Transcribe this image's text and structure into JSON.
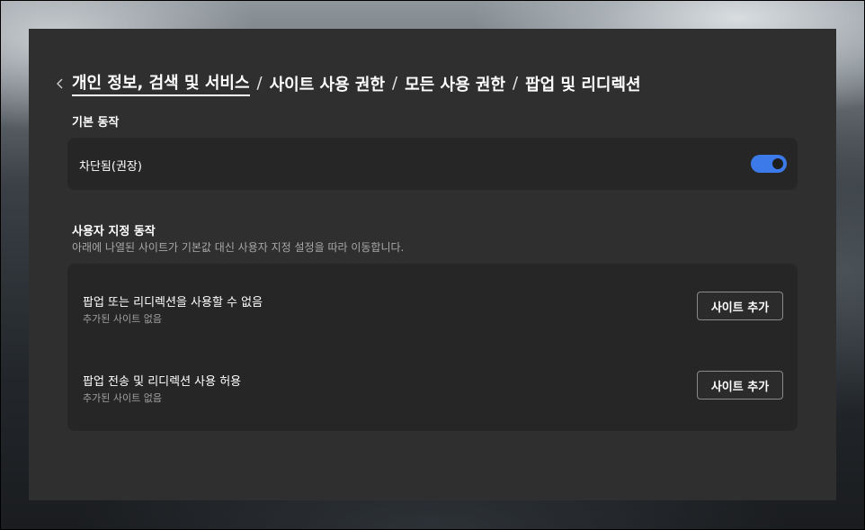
{
  "breadcrumb": {
    "items": [
      "개인 정보, 검색 및 서비스",
      "사이트 사용 권한",
      "모든 사용 권한",
      "팝업 및 리디렉션"
    ],
    "separator": "/"
  },
  "default_behavior": {
    "title": "기본 동작",
    "setting_label": "차단됨(권장)",
    "toggle_on": true,
    "toggle_color": "#3b7ae8"
  },
  "custom_behavior": {
    "title": "사용자 지정 동작",
    "description": "아래에 나열된 사이트가 기본값 대신 사용자 지정 설정을 따라 이동합니다.",
    "rows": [
      {
        "label": "팝업 또는 리디렉션을 사용할 수 없음",
        "sublabel": "추가된 사이트 없음",
        "button": "사이트 추가"
      },
      {
        "label": "팝업 전송 및 리디렉션 사용 허용",
        "sublabel": "추가된 사이트 없음",
        "button": "사이트 추가"
      }
    ]
  }
}
